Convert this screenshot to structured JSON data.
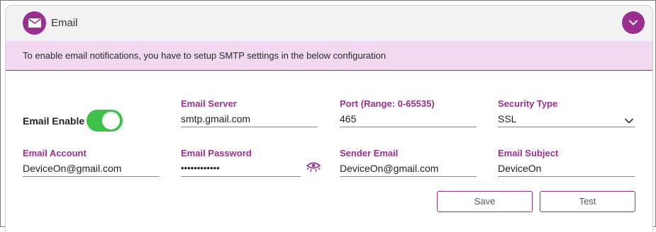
{
  "header": {
    "title": "Email",
    "icon": "envelope-icon",
    "collapse_icon": "chevron-down-icon",
    "accent": "#9b2f8f"
  },
  "notice": {
    "text": "To enable email notifications, you have to setup SMTP settings in the below configuration",
    "background": "#f3d9ef"
  },
  "email_enable": {
    "label": "Email Enable",
    "on": true,
    "color": "#3ec24c"
  },
  "fields": {
    "server": {
      "label": "Email Server",
      "value": "smtp.gmail.com"
    },
    "port": {
      "label": "Port (Range: 0-65535)",
      "value": "465"
    },
    "security": {
      "label": "Security Type",
      "value": "SSL"
    },
    "account": {
      "label": "Email Account",
      "value": "DeviceOn@gmail.com"
    },
    "password": {
      "label": "Email Password",
      "value": "••••••••••••"
    },
    "sender": {
      "label": "Sender Email",
      "value": "DeviceOn@gmail.com"
    },
    "subject": {
      "label": "Email Subject",
      "value": "DeviceOn"
    }
  },
  "buttons": {
    "save": "Save",
    "test": "Test"
  }
}
